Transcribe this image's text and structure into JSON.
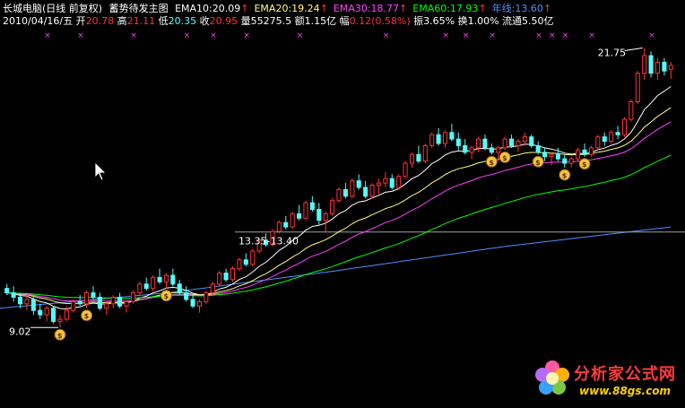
{
  "header": {
    "stock_name": "长城电脑",
    "period": "(日线 前复权)",
    "indicator_name": "蓄势待发主图",
    "date": "2010/04/16/五",
    "open_label": "开",
    "open": "20.78",
    "high_label": "高",
    "high": "21.11",
    "low_label": "低",
    "low": "20.35",
    "close_label": "收",
    "close": "20.95",
    "volume_label": "量",
    "volume": "55275.5",
    "amount_label": "额",
    "amount": "1.15亿",
    "change_label": "幅",
    "change": "0.12(0.58%)",
    "amplitude_label": "振",
    "amplitude": "3.65%",
    "turnover_label": "换",
    "turnover": "1.00%",
    "float_label": "流通",
    "float": "5.50亿"
  },
  "ema_labels": [
    {
      "name": "EMA10",
      "value": "20.09",
      "color": "#ffffff"
    },
    {
      "name": "EMA20",
      "value": "19.24",
      "color": "#ffff80"
    },
    {
      "name": "EMA30",
      "value": "18.77",
      "color": "#ff40ff"
    },
    {
      "name": "EMA60",
      "value": "17.93",
      "color": "#00ff00"
    },
    {
      "name": "年线",
      "value": "13.60",
      "color": "#4f8fff"
    }
  ],
  "annotations": {
    "high_price": "21.75",
    "low_price": "9.02",
    "support_level": "13.35-13.40"
  },
  "watermark": {
    "title": "分析家公式网",
    "url": "www.88gs.com"
  },
  "colors": {
    "up": "#ff3232",
    "down": "#54fcfc",
    "ema10": "#ffffff",
    "ema20": "#ffff80",
    "ema30": "#ff40ff",
    "ema60": "#00ff00",
    "annual": "#4f8fff",
    "signal": "#ff40ff",
    "level_line": "#a0a0a0"
  },
  "chart_data": {
    "type": "candlestick",
    "y_range": [
      8.5,
      22.3
    ],
    "candles": [
      [
        10.8,
        11.0,
        10.5,
        10.6
      ],
      [
        10.6,
        10.9,
        10.2,
        10.4
      ],
      [
        10.4,
        10.6,
        9.9,
        10.1
      ],
      [
        10.1,
        10.5,
        9.8,
        10.3
      ],
      [
        10.3,
        10.4,
        9.6,
        9.8
      ],
      [
        9.8,
        10.1,
        9.4,
        9.6
      ],
      [
        9.6,
        10.0,
        9.3,
        9.9
      ],
      [
        9.9,
        10.0,
        9.2,
        9.3
      ],
      [
        9.3,
        9.6,
        9.02,
        9.4
      ],
      [
        9.4,
        10.0,
        9.3,
        9.8
      ],
      [
        9.8,
        10.3,
        9.7,
        10.2
      ],
      [
        10.2,
        10.5,
        10.0,
        10.1
      ],
      [
        10.1,
        10.7,
        9.9,
        10.6
      ],
      [
        10.6,
        10.9,
        10.3,
        10.4
      ],
      [
        10.4,
        10.6,
        9.8,
        9.9
      ],
      [
        9.9,
        10.2,
        9.6,
        10.1
      ],
      [
        10.1,
        10.5,
        9.9,
        10.4
      ],
      [
        10.4,
        10.6,
        9.9,
        10.0
      ],
      [
        10.0,
        10.3,
        9.7,
        10.2
      ],
      [
        10.2,
        10.7,
        10.1,
        10.6
      ],
      [
        10.6,
        11.1,
        10.5,
        11.0
      ],
      [
        11.0,
        11.3,
        10.7,
        10.8
      ],
      [
        10.8,
        11.4,
        10.7,
        11.3
      ],
      [
        11.3,
        11.7,
        11.0,
        11.1
      ],
      [
        11.1,
        11.5,
        10.8,
        11.4
      ],
      [
        11.4,
        11.7,
        10.9,
        11.0
      ],
      [
        11.0,
        11.2,
        10.5,
        10.6
      ],
      [
        10.6,
        10.9,
        10.2,
        10.3
      ],
      [
        10.3,
        10.6,
        9.9,
        10.0
      ],
      [
        10.0,
        10.3,
        9.7,
        10.2
      ],
      [
        10.2,
        10.7,
        10.1,
        10.6
      ],
      [
        10.6,
        11.1,
        10.5,
        11.0
      ],
      [
        11.0,
        11.6,
        10.9,
        11.5
      ],
      [
        11.5,
        11.7,
        11.1,
        11.2
      ],
      [
        11.2,
        11.8,
        11.1,
        11.7
      ],
      [
        11.7,
        12.2,
        11.6,
        12.1
      ],
      [
        12.1,
        12.4,
        11.8,
        11.9
      ],
      [
        11.9,
        12.6,
        11.8,
        12.5
      ],
      [
        12.5,
        13.1,
        12.4,
        13.0
      ],
      [
        13.0,
        13.3,
        12.7,
        12.8
      ],
      [
        12.8,
        13.5,
        12.7,
        13.4
      ],
      [
        13.4,
        13.9,
        13.3,
        13.8
      ],
      [
        13.8,
        14.1,
        13.5,
        13.6
      ],
      [
        13.6,
        14.3,
        13.5,
        14.2
      ],
      [
        14.2,
        14.6,
        13.9,
        14.0
      ],
      [
        14.0,
        14.8,
        13.9,
        14.7
      ],
      [
        14.7,
        15.0,
        14.3,
        14.4
      ],
      [
        14.4,
        14.7,
        13.7,
        13.9
      ],
      [
        13.9,
        14.3,
        13.4,
        14.2
      ],
      [
        14.2,
        14.9,
        14.1,
        14.8
      ],
      [
        14.8,
        15.4,
        14.7,
        15.3
      ],
      [
        15.3,
        15.6,
        14.9,
        15.0
      ],
      [
        15.0,
        15.8,
        14.9,
        15.7
      ],
      [
        15.7,
        16.0,
        15.3,
        15.4
      ],
      [
        15.4,
        15.7,
        14.9,
        15.0
      ],
      [
        15.0,
        15.6,
        14.9,
        15.5
      ],
      [
        15.5,
        15.8,
        15.1,
        15.6
      ],
      [
        15.6,
        16.1,
        15.4,
        15.8
      ],
      [
        15.8,
        16.0,
        15.3,
        15.4
      ],
      [
        15.4,
        16.0,
        15.3,
        15.9
      ],
      [
        15.9,
        16.6,
        15.8,
        16.5
      ],
      [
        16.5,
        17.0,
        16.3,
        16.9
      ],
      [
        16.9,
        17.3,
        16.5,
        16.6
      ],
      [
        16.6,
        17.4,
        16.5,
        17.3
      ],
      [
        17.3,
        17.9,
        17.2,
        17.8
      ],
      [
        17.8,
        18.1,
        17.3,
        17.4
      ],
      [
        17.4,
        18.0,
        17.2,
        17.9
      ],
      [
        17.9,
        18.3,
        17.5,
        17.6
      ],
      [
        17.6,
        17.9,
        17.1,
        17.3
      ],
      [
        17.3,
        17.6,
        16.9,
        17.0
      ],
      [
        17.0,
        17.3,
        16.7,
        17.2
      ],
      [
        17.2,
        17.7,
        17.0,
        17.6
      ],
      [
        17.6,
        17.8,
        17.1,
        17.2
      ],
      [
        17.2,
        17.4,
        16.9,
        17.0
      ],
      [
        17.0,
        17.3,
        16.6,
        17.2
      ],
      [
        17.2,
        17.7,
        17.1,
        17.6
      ],
      [
        17.6,
        17.8,
        17.2,
        17.3
      ],
      [
        17.3,
        17.6,
        17.0,
        17.5
      ],
      [
        17.5,
        17.9,
        17.3,
        17.7
      ],
      [
        17.7,
        17.8,
        17.2,
        17.3
      ],
      [
        17.3,
        17.5,
        16.9,
        17.0
      ],
      [
        17.0,
        17.2,
        16.6,
        16.8
      ],
      [
        16.8,
        17.0,
        16.4,
        16.9
      ],
      [
        16.9,
        17.2,
        16.6,
        16.7
      ],
      [
        16.7,
        16.9,
        16.3,
        16.5
      ],
      [
        16.5,
        16.8,
        16.3,
        16.7
      ],
      [
        16.7,
        17.2,
        16.6,
        17.1
      ],
      [
        17.1,
        17.4,
        16.8,
        16.9
      ],
      [
        16.9,
        17.3,
        16.8,
        17.2
      ],
      [
        17.2,
        17.8,
        17.1,
        17.7
      ],
      [
        17.7,
        17.9,
        17.3,
        17.5
      ],
      [
        17.5,
        18.0,
        17.4,
        17.9
      ],
      [
        17.9,
        18.2,
        17.6,
        17.8
      ],
      [
        17.8,
        18.6,
        17.7,
        18.5
      ],
      [
        18.5,
        19.4,
        18.4,
        19.3
      ],
      [
        19.3,
        20.7,
        19.2,
        20.6
      ],
      [
        20.6,
        21.75,
        20.3,
        21.4
      ],
      [
        21.4,
        21.6,
        20.4,
        20.6
      ],
      [
        20.6,
        21.3,
        20.3,
        21.1
      ],
      [
        21.1,
        21.3,
        20.5,
        20.7
      ],
      [
        20.78,
        21.11,
        20.35,
        20.95
      ]
    ],
    "annual_line": {
      "x_range": [
        0,
        100
      ],
      "values": [
        9.9,
        10.6,
        11.6,
        12.7,
        13.6
      ]
    },
    "support_line_value": 13.37,
    "signal_days": [
      6,
      11,
      19,
      27,
      31,
      36,
      44,
      57,
      66,
      69,
      73,
      80,
      82,
      84,
      88,
      97
    ],
    "money_bag_days": [
      8,
      12,
      24,
      73,
      75,
      80,
      84,
      87
    ]
  }
}
